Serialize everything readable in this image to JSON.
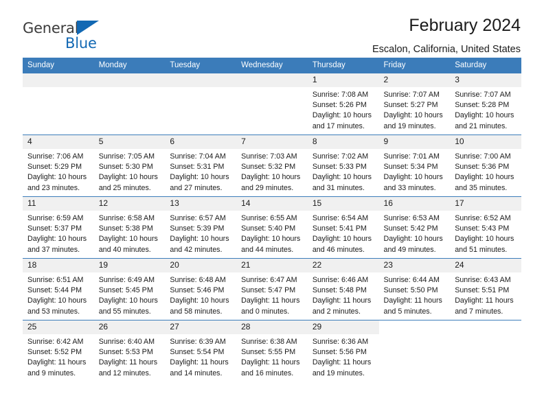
{
  "brand": {
    "name_part1": "General",
    "name_part2": "Blue",
    "logo_icon": "triangle-logo-icon"
  },
  "header": {
    "title": "February 2024",
    "location": "Escalon, California, United States"
  },
  "colors": {
    "header_blue": "#3b7cba",
    "brand_blue": "#1268b3",
    "daynum_band": "#f0f0f0",
    "text": "#1a1a1a"
  },
  "calendar": {
    "weekday_headers": [
      "Sunday",
      "Monday",
      "Tuesday",
      "Wednesday",
      "Thursday",
      "Friday",
      "Saturday"
    ],
    "weeks": [
      [
        {
          "day": "",
          "empty": true
        },
        {
          "day": "",
          "empty": true
        },
        {
          "day": "",
          "empty": true
        },
        {
          "day": "",
          "empty": true
        },
        {
          "day": "1",
          "sunrise": "Sunrise: 7:08 AM",
          "sunset": "Sunset: 5:26 PM",
          "daylight": "Daylight: 10 hours and 17 minutes."
        },
        {
          "day": "2",
          "sunrise": "Sunrise: 7:07 AM",
          "sunset": "Sunset: 5:27 PM",
          "daylight": "Daylight: 10 hours and 19 minutes."
        },
        {
          "day": "3",
          "sunrise": "Sunrise: 7:07 AM",
          "sunset": "Sunset: 5:28 PM",
          "daylight": "Daylight: 10 hours and 21 minutes."
        }
      ],
      [
        {
          "day": "4",
          "sunrise": "Sunrise: 7:06 AM",
          "sunset": "Sunset: 5:29 PM",
          "daylight": "Daylight: 10 hours and 23 minutes."
        },
        {
          "day": "5",
          "sunrise": "Sunrise: 7:05 AM",
          "sunset": "Sunset: 5:30 PM",
          "daylight": "Daylight: 10 hours and 25 minutes."
        },
        {
          "day": "6",
          "sunrise": "Sunrise: 7:04 AM",
          "sunset": "Sunset: 5:31 PM",
          "daylight": "Daylight: 10 hours and 27 minutes."
        },
        {
          "day": "7",
          "sunrise": "Sunrise: 7:03 AM",
          "sunset": "Sunset: 5:32 PM",
          "daylight": "Daylight: 10 hours and 29 minutes."
        },
        {
          "day": "8",
          "sunrise": "Sunrise: 7:02 AM",
          "sunset": "Sunset: 5:33 PM",
          "daylight": "Daylight: 10 hours and 31 minutes."
        },
        {
          "day": "9",
          "sunrise": "Sunrise: 7:01 AM",
          "sunset": "Sunset: 5:34 PM",
          "daylight": "Daylight: 10 hours and 33 minutes."
        },
        {
          "day": "10",
          "sunrise": "Sunrise: 7:00 AM",
          "sunset": "Sunset: 5:36 PM",
          "daylight": "Daylight: 10 hours and 35 minutes."
        }
      ],
      [
        {
          "day": "11",
          "sunrise": "Sunrise: 6:59 AM",
          "sunset": "Sunset: 5:37 PM",
          "daylight": "Daylight: 10 hours and 37 minutes."
        },
        {
          "day": "12",
          "sunrise": "Sunrise: 6:58 AM",
          "sunset": "Sunset: 5:38 PM",
          "daylight": "Daylight: 10 hours and 40 minutes."
        },
        {
          "day": "13",
          "sunrise": "Sunrise: 6:57 AM",
          "sunset": "Sunset: 5:39 PM",
          "daylight": "Daylight: 10 hours and 42 minutes."
        },
        {
          "day": "14",
          "sunrise": "Sunrise: 6:55 AM",
          "sunset": "Sunset: 5:40 PM",
          "daylight": "Daylight: 10 hours and 44 minutes."
        },
        {
          "day": "15",
          "sunrise": "Sunrise: 6:54 AM",
          "sunset": "Sunset: 5:41 PM",
          "daylight": "Daylight: 10 hours and 46 minutes."
        },
        {
          "day": "16",
          "sunrise": "Sunrise: 6:53 AM",
          "sunset": "Sunset: 5:42 PM",
          "daylight": "Daylight: 10 hours and 49 minutes."
        },
        {
          "day": "17",
          "sunrise": "Sunrise: 6:52 AM",
          "sunset": "Sunset: 5:43 PM",
          "daylight": "Daylight: 10 hours and 51 minutes."
        }
      ],
      [
        {
          "day": "18",
          "sunrise": "Sunrise: 6:51 AM",
          "sunset": "Sunset: 5:44 PM",
          "daylight": "Daylight: 10 hours and 53 minutes."
        },
        {
          "day": "19",
          "sunrise": "Sunrise: 6:49 AM",
          "sunset": "Sunset: 5:45 PM",
          "daylight": "Daylight: 10 hours and 55 minutes."
        },
        {
          "day": "20",
          "sunrise": "Sunrise: 6:48 AM",
          "sunset": "Sunset: 5:46 PM",
          "daylight": "Daylight: 10 hours and 58 minutes."
        },
        {
          "day": "21",
          "sunrise": "Sunrise: 6:47 AM",
          "sunset": "Sunset: 5:47 PM",
          "daylight": "Daylight: 11 hours and 0 minutes."
        },
        {
          "day": "22",
          "sunrise": "Sunrise: 6:46 AM",
          "sunset": "Sunset: 5:48 PM",
          "daylight": "Daylight: 11 hours and 2 minutes."
        },
        {
          "day": "23",
          "sunrise": "Sunrise: 6:44 AM",
          "sunset": "Sunset: 5:50 PM",
          "daylight": "Daylight: 11 hours and 5 minutes."
        },
        {
          "day": "24",
          "sunrise": "Sunrise: 6:43 AM",
          "sunset": "Sunset: 5:51 PM",
          "daylight": "Daylight: 11 hours and 7 minutes."
        }
      ],
      [
        {
          "day": "25",
          "sunrise": "Sunrise: 6:42 AM",
          "sunset": "Sunset: 5:52 PM",
          "daylight": "Daylight: 11 hours and 9 minutes."
        },
        {
          "day": "26",
          "sunrise": "Sunrise: 6:40 AM",
          "sunset": "Sunset: 5:53 PM",
          "daylight": "Daylight: 11 hours and 12 minutes."
        },
        {
          "day": "27",
          "sunrise": "Sunrise: 6:39 AM",
          "sunset": "Sunset: 5:54 PM",
          "daylight": "Daylight: 11 hours and 14 minutes."
        },
        {
          "day": "28",
          "sunrise": "Sunrise: 6:38 AM",
          "sunset": "Sunset: 5:55 PM",
          "daylight": "Daylight: 11 hours and 16 minutes."
        },
        {
          "day": "29",
          "sunrise": "Sunrise: 6:36 AM",
          "sunset": "Sunset: 5:56 PM",
          "daylight": "Daylight: 11 hours and 19 minutes."
        },
        {
          "day": "",
          "blank": true
        },
        {
          "day": "",
          "blank": true
        }
      ]
    ]
  }
}
